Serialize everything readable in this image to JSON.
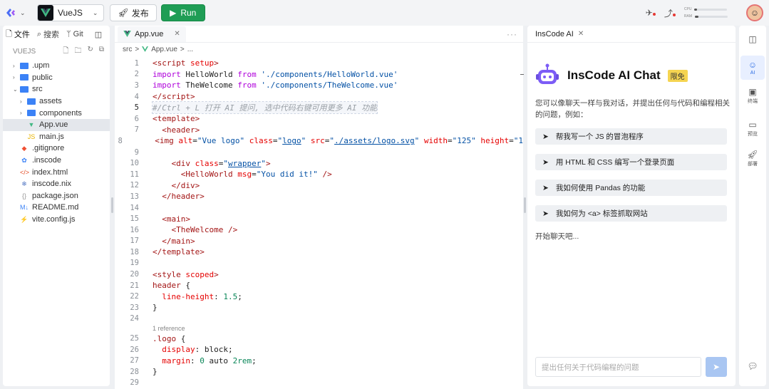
{
  "topbar": {
    "project_name": "VueJS",
    "publish_label": "发布",
    "run_label": "Run",
    "meters": [
      {
        "label": "CPU",
        "value_percent": 8
      },
      {
        "label": "RAM",
        "value_percent": 10
      }
    ]
  },
  "filepanel": {
    "tabs": [
      {
        "label": "文件",
        "icon": "file-icon",
        "active": true
      },
      {
        "label": "搜索",
        "icon": "search-icon",
        "active": false
      },
      {
        "label": "Git",
        "icon": "git-branch-icon",
        "active": false
      }
    ],
    "root": "VUEJS",
    "tree": [
      {
        "name": ".upm",
        "type": "folder",
        "depth": 0,
        "expanded": false
      },
      {
        "name": "public",
        "type": "folder",
        "depth": 0,
        "expanded": false
      },
      {
        "name": "src",
        "type": "folder",
        "depth": 0,
        "expanded": true
      },
      {
        "name": "assets",
        "type": "folder",
        "depth": 1,
        "expanded": false
      },
      {
        "name": "components",
        "type": "folder",
        "depth": 1,
        "expanded": false
      },
      {
        "name": "App.vue",
        "type": "vue",
        "depth": 1,
        "selected": true
      },
      {
        "name": "main.js",
        "type": "js",
        "depth": 1
      },
      {
        "name": ".gitignore",
        "type": "git",
        "depth": 0
      },
      {
        "name": ".inscode",
        "type": "config",
        "depth": 0
      },
      {
        "name": "index.html",
        "type": "html",
        "depth": 0
      },
      {
        "name": "inscode.nix",
        "type": "nix",
        "depth": 0
      },
      {
        "name": "package.json",
        "type": "json",
        "depth": 0
      },
      {
        "name": "README.md",
        "type": "md",
        "depth": 0
      },
      {
        "name": "vite.config.js",
        "type": "vite",
        "depth": 0
      }
    ]
  },
  "editor": {
    "tab_label": "App.vue",
    "breadcrumb": [
      "src",
      ">",
      "App.vue",
      ">",
      "..."
    ],
    "reference_hint": "1 reference",
    "lines": [
      {
        "n": 1,
        "html": "<span class='tag'>&lt;script</span> <span class='attr'>setup</span><span class='tag'>&gt;</span>"
      },
      {
        "n": 2,
        "html": "<span class='kw'>import</span> HelloWorld <span class='kw'>from</span> <span class='str'>'./components/HelloWorld.vue'</span>"
      },
      {
        "n": 3,
        "html": "<span class='kw'>import</span> TheWelcome <span class='kw'>from</span> <span class='str'>'./components/TheWelcome.vue'</span>"
      },
      {
        "n": 4,
        "html": "<span class='tag'>&lt;/script&gt;</span>"
      },
      {
        "n": 5,
        "html": "<span class='comment'>#/Ctrl + L 打开 AI 提问, 选中代码右键可用更多 AI 功能</span>",
        "current": true
      },
      {
        "n": 6,
        "html": "<span class='tag'>&lt;template&gt;</span>"
      },
      {
        "n": 7,
        "html": "  <span class='tag'>&lt;header&gt;</span>"
      },
      {
        "n": 8,
        "html": "    <span class='tag'>&lt;img</span> <span class='attr'>alt</span>=<span class='str'>\"Vue logo\"</span> <span class='attr'>class</span>=<span class='str'>\"<span class='link'>logo</span>\"</span> <span class='attr'>src</span>=<span class='str'>\"<span class='link'>./assets/logo.svg</span>\"</span> <span class='attr'>width</span>=<span class='str'>\"125\"</span> <span class='attr'>height</span>=<span class='str'>\"1</span>"
      },
      {
        "n": 9,
        "html": ""
      },
      {
        "n": 10,
        "html": "    <span class='tag'>&lt;div</span> <span class='attr'>class</span>=<span class='str'>\"<span class='link'>wrapper</span>\"</span><span class='tag'>&gt;</span>"
      },
      {
        "n": 11,
        "html": "      <span class='tag'>&lt;HelloWorld</span> <span class='attr'>msg</span>=<span class='str'>\"You did it!\"</span> <span class='tag'>/&gt;</span>"
      },
      {
        "n": 12,
        "html": "    <span class='tag'>&lt;/div&gt;</span>"
      },
      {
        "n": 13,
        "html": "  <span class='tag'>&lt;/header&gt;</span>"
      },
      {
        "n": 14,
        "html": ""
      },
      {
        "n": 15,
        "html": "  <span class='tag'>&lt;main&gt;</span>"
      },
      {
        "n": 16,
        "html": "    <span class='tag'>&lt;TheWelcome</span> <span class='tag'>/&gt;</span>"
      },
      {
        "n": 17,
        "html": "  <span class='tag'>&lt;/main&gt;</span>"
      },
      {
        "n": 18,
        "html": "<span class='tag'>&lt;/template&gt;</span>"
      },
      {
        "n": 19,
        "html": ""
      },
      {
        "n": 20,
        "html": "<span class='tag'>&lt;style</span> <span class='attr'>scoped</span><span class='tag'>&gt;</span>"
      },
      {
        "n": 21,
        "html": "<span class='tag'>header</span> {"
      },
      {
        "n": 22,
        "html": "  <span class='attr'>line-height</span>: <span class='num'>1.5</span>;"
      },
      {
        "n": 23,
        "html": "}"
      },
      {
        "n": 24,
        "html": ""
      },
      {
        "n": 25,
        "html": "<span class='tag'>.logo</span> {"
      },
      {
        "n": 26,
        "html": "  <span class='attr'>display</span>: block;"
      },
      {
        "n": 27,
        "html": "  <span class='attr'>margin</span>: <span class='num'>0</span> auto <span class='num'>2rem</span>;"
      },
      {
        "n": 28,
        "html": "}"
      },
      {
        "n": 29,
        "html": ""
      }
    ]
  },
  "ai": {
    "tab_label": "InsCode AI",
    "title": "InsCode AI Chat",
    "badge": "限免",
    "description": "您可以像聊天一样与我对话，并提出任何与代码和编程相关的问题，例如：",
    "suggestions": [
      "帮我写一个 JS 的冒泡程序",
      "用 HTML 和 CSS 编写一个登录页面",
      "我如何使用 Pandas 的功能",
      "我如何为 <a> 标签抓取网站"
    ],
    "start_chat": "开始聊天吧...",
    "input_placeholder": "提出任何关于代码编程的问题"
  },
  "rsidebar": {
    "items": [
      {
        "label": "",
        "icon": "layout-panel-icon"
      },
      {
        "label": "AI",
        "icon": "ai-robot-icon",
        "active": true
      },
      {
        "label": "终端",
        "icon": "terminal-icon"
      },
      {
        "label": "预览",
        "icon": "preview-monitor-icon"
      },
      {
        "label": "部署",
        "icon": "deploy-rocket-icon"
      },
      {
        "label": "",
        "icon": "chat-feedback-icon"
      }
    ]
  }
}
